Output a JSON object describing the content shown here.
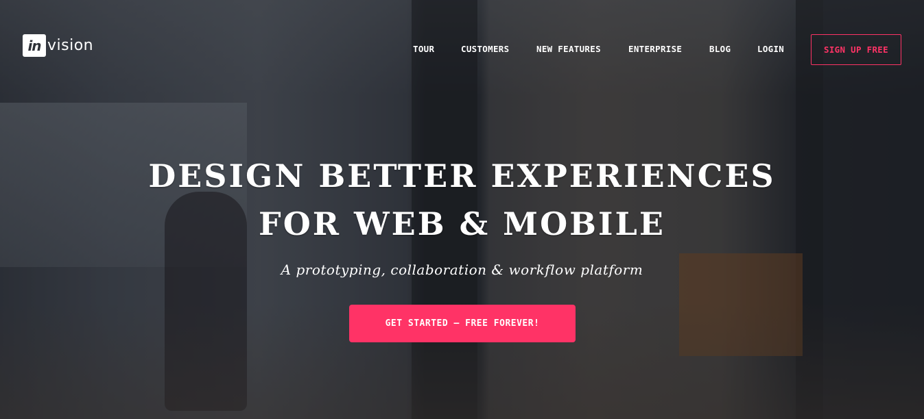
{
  "brand": {
    "logo_mark": "in",
    "logo_word": "vision"
  },
  "nav": {
    "items": [
      {
        "label": "TOUR"
      },
      {
        "label": "CUSTOMERS"
      },
      {
        "label": "NEW FEATURES"
      },
      {
        "label": "ENTERPRISE"
      },
      {
        "label": "BLOG"
      },
      {
        "label": "LOGIN"
      }
    ],
    "signup_label": "SIGN UP FREE"
  },
  "hero": {
    "headline_line1": "DESIGN BETTER EXPERIENCES",
    "headline_line2": "FOR WEB & MOBILE",
    "subtitle": "A prototyping, collaboration & workflow platform",
    "cta_label": "GET STARTED — FREE FOREVER!"
  },
  "colors": {
    "accent": "#ff3366",
    "overlay": "#181a20"
  }
}
